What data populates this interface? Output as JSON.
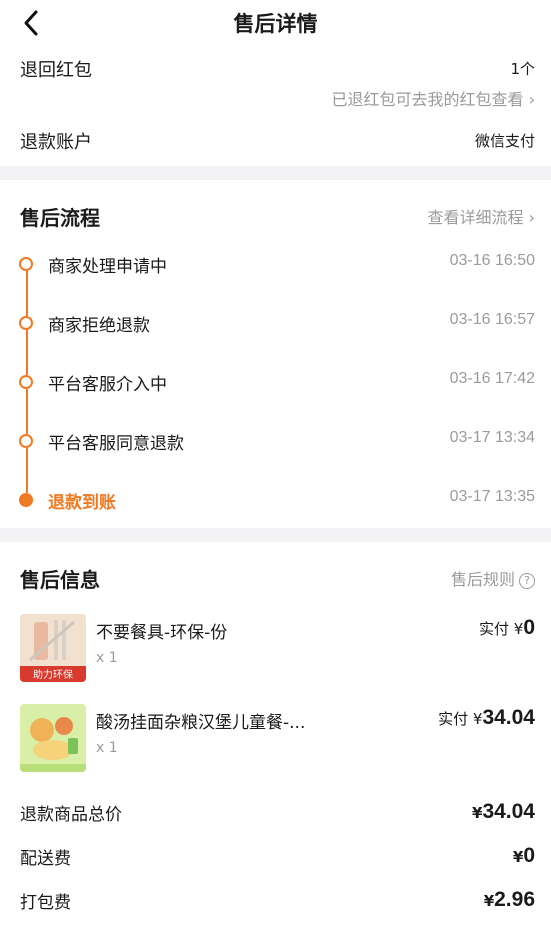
{
  "header": {
    "title": "售后详情"
  },
  "refund": {
    "hongbao_label": "退回红包",
    "hongbao_count": "1个",
    "hongbao_note": "已退红包可去我的红包查看",
    "account_label": "退款账户",
    "account_value": "微信支付"
  },
  "process": {
    "title": "售后流程",
    "detail_link": "查看详细流程",
    "steps": [
      {
        "label": "商家处理申请中",
        "time": "03-16 16:50"
      },
      {
        "label": "商家拒绝退款",
        "time": "03-16 16:57"
      },
      {
        "label": "平台客服介入中",
        "time": "03-16 17:42"
      },
      {
        "label": "平台客服同意退款",
        "time": "03-17 13:34"
      },
      {
        "label": "退款到账",
        "time": "03-17 13:35"
      }
    ]
  },
  "info": {
    "title": "售后信息",
    "rules_link": "售后规则",
    "products": [
      {
        "name": "不要餐具-环保-份",
        "qty": "x 1",
        "paid_prefix": "实付",
        "currency": "¥",
        "amount": "0",
        "badge": "助力环保"
      },
      {
        "name": "酸汤挂面杂粮汉堡儿童餐-...",
        "qty": "x 1",
        "paid_prefix": "实付",
        "currency": "¥",
        "amount": "34.04"
      }
    ],
    "summary": [
      {
        "label": "退款商品总价",
        "currency": "¥",
        "amount": "34.04"
      },
      {
        "label": "配送费",
        "currency": "¥",
        "amount": "0"
      },
      {
        "label": "打包费",
        "currency": "¥",
        "amount": "2.96"
      }
    ]
  },
  "colors": {
    "accent": "#f07a22",
    "muted": "#9b9b9b",
    "divider": "#f3f3f5"
  }
}
